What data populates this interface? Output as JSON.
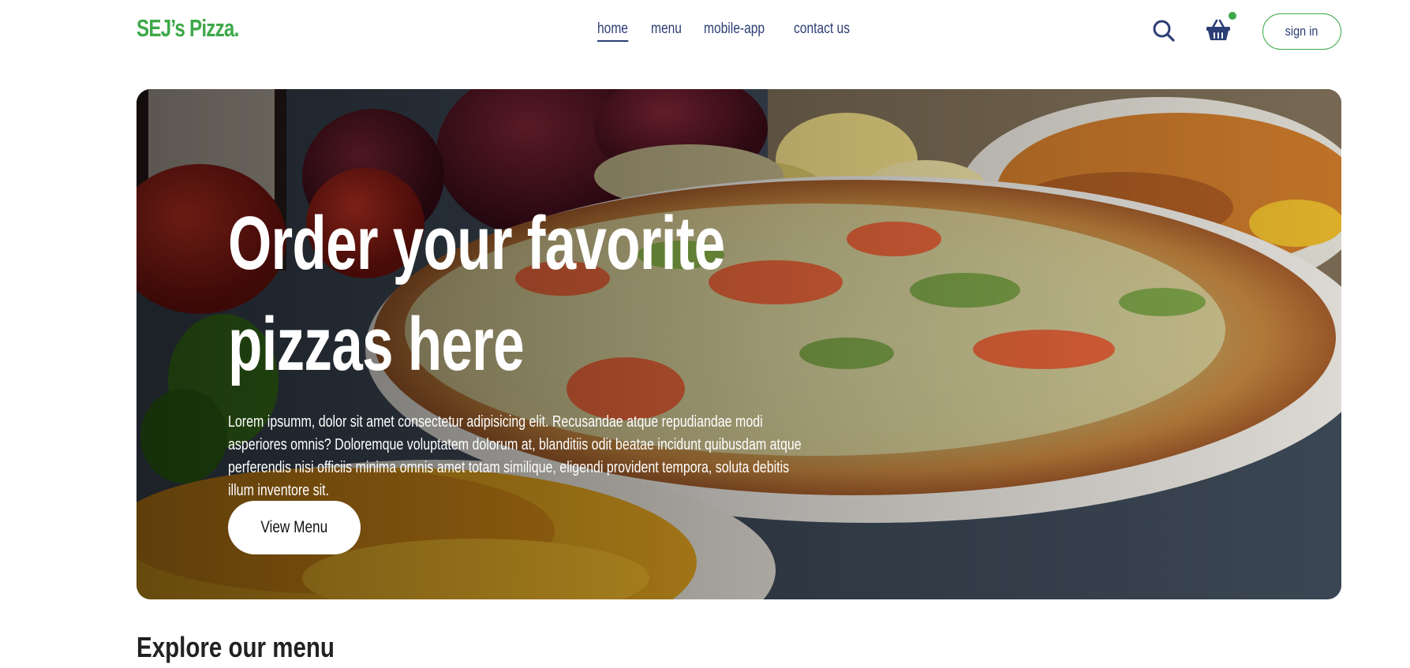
{
  "brand": {
    "logo_text": "SEJ’s Pizza.",
    "primary_color": "#3ea84a",
    "nav_color": "#2c3e75"
  },
  "nav": {
    "links": [
      {
        "label": "home",
        "active": true
      },
      {
        "label": "menu",
        "active": false
      },
      {
        "label": "mobile-app",
        "active": false
      },
      {
        "label": "contact us",
        "active": false
      }
    ]
  },
  "header_actions": {
    "search_icon": "search-icon",
    "cart_icon": "basket-icon",
    "cart_indicator": true,
    "signin_label": "sign in"
  },
  "hero": {
    "title_line1": "Order your favorite",
    "title_line2": "pizzas here",
    "description": "Lorem ipsumm, dolor sit amet consectetur adipisicing elit. Recusandae atque repudiandae modi asperiores omnis? Doloremque voluptatem dolorum at, blanditiis odit beatae incidunt quibusdam atque perferendis nisi officiis minima omnis amet totam similique, eligendi provident tempora, soluta debitis illum inventore sit.",
    "cta_label": "View Menu"
  },
  "explore": {
    "heading": "Explore our menu"
  }
}
